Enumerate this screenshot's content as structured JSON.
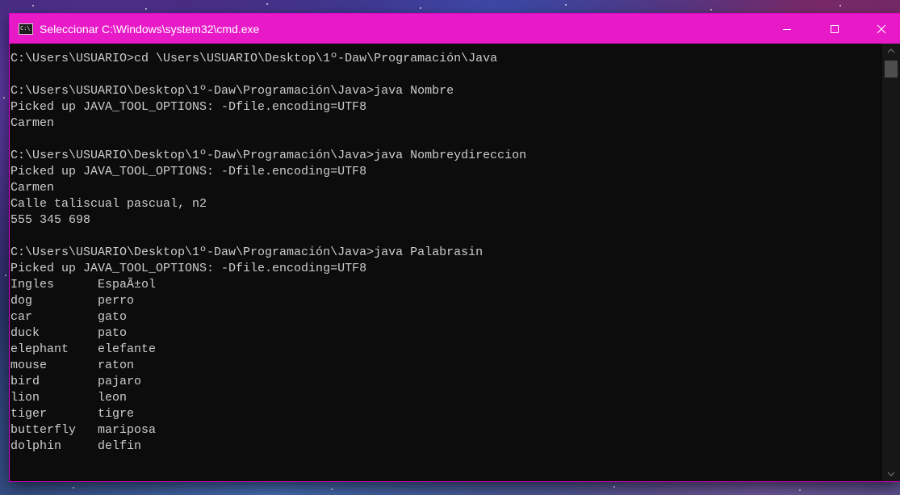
{
  "window": {
    "title": "Seleccionar C:\\Windows\\system32\\cmd.exe",
    "accent_color": "#e81ac8",
    "icons": {
      "app": "cmd-icon",
      "minimize": "minimize-icon",
      "maximize": "maximize-icon",
      "close": "close-icon"
    }
  },
  "console": {
    "lines": [
      "",
      "C:\\Users\\USUARIO>cd \\Users\\USUARIO\\Desktop\\1º-Daw\\Programación\\Java",
      "",
      "C:\\Users\\USUARIO\\Desktop\\1º-Daw\\Programación\\Java>java Nombre",
      "Picked up JAVA_TOOL_OPTIONS: -Dfile.encoding=UTF8",
      "Carmen",
      "",
      "C:\\Users\\USUARIO\\Desktop\\1º-Daw\\Programación\\Java>java Nombreydireccion",
      "Picked up JAVA_TOOL_OPTIONS: -Dfile.encoding=UTF8",
      "Carmen",
      "Calle taliscual pascual, n2",
      "555 345 698",
      "",
      "C:\\Users\\USUARIO\\Desktop\\1º-Daw\\Programación\\Java>java Palabrasin",
      "Picked up JAVA_TOOL_OPTIONS: -Dfile.encoding=UTF8",
      "Ingles      EspaÃ±ol",
      "dog         perro",
      "car         gato",
      "duck        pato",
      "elephant    elefante",
      "mouse       raton",
      "bird        pajaro",
      "lion        leon",
      "tiger       tigre",
      "butterfly   mariposa",
      "dolphin     delfin"
    ]
  }
}
